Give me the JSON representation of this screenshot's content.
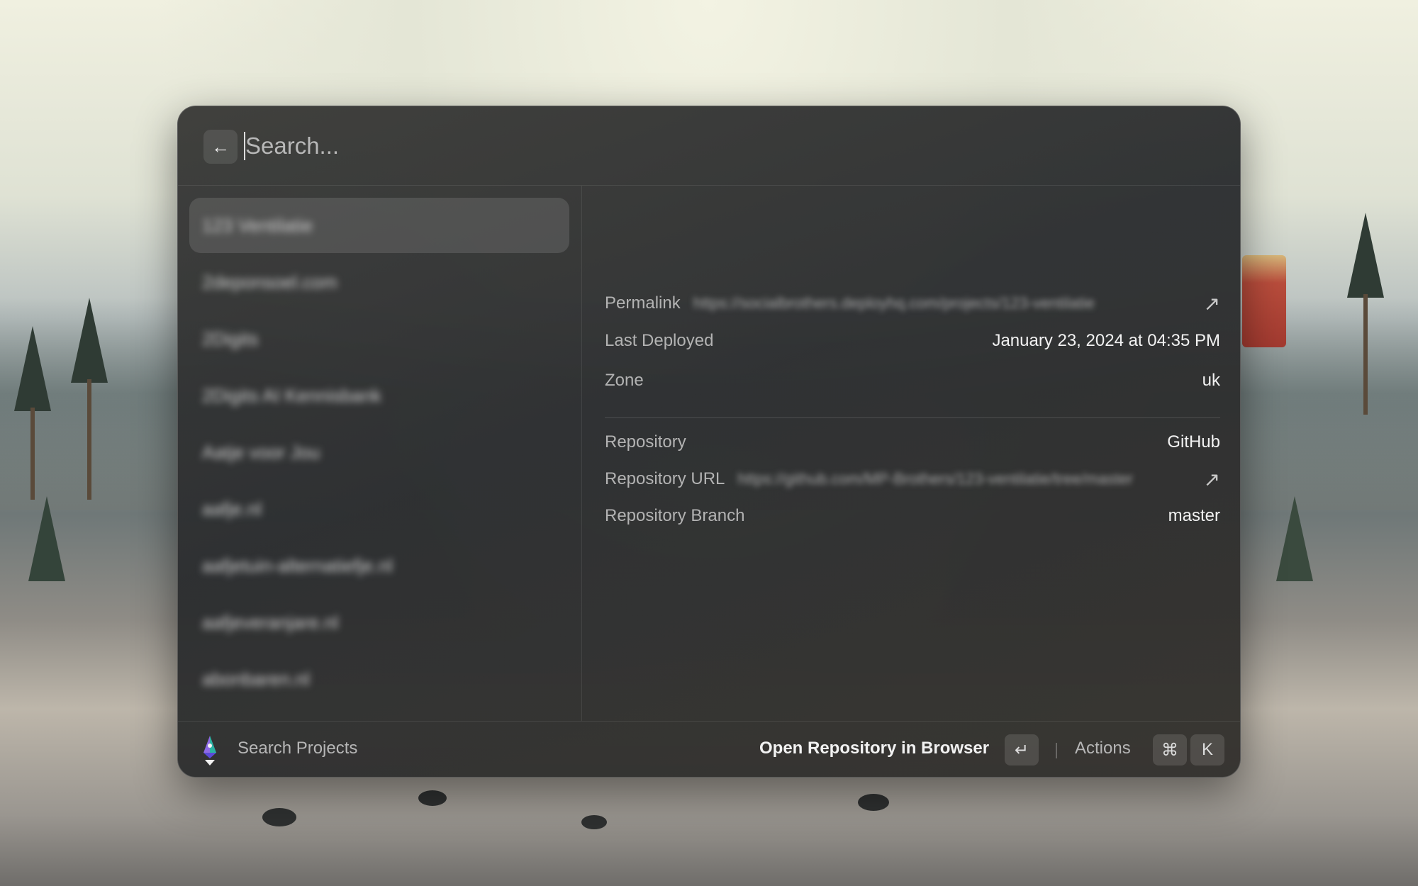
{
  "search": {
    "placeholder": "Search..."
  },
  "header": {
    "back_icon": "arrow-left-icon"
  },
  "projects": [
    {
      "label": "123 Ventilatie",
      "selected": true
    },
    {
      "label": "2deponsoel.com",
      "selected": false
    },
    {
      "label": "2Digits",
      "selected": false
    },
    {
      "label": "2Digits AI Kennisbank",
      "selected": false
    },
    {
      "label": "Aatje voor Jou",
      "selected": false
    },
    {
      "label": "aafje.nl",
      "selected": false
    },
    {
      "label": "aafjetuin-alternatiefje.nl",
      "selected": false
    },
    {
      "label": "aafjeveranjare.nl",
      "selected": false
    },
    {
      "label": "abonbaren.nl",
      "selected": false
    }
  ],
  "detail": {
    "permalink_label": "Permalink",
    "permalink_value": "https://socialbrothers.deployhq.com/projects/123-ventilatie",
    "last_deployed_label": "Last Deployed",
    "last_deployed_value": "January 23, 2024 at 04:35 PM",
    "zone_label": "Zone",
    "zone_value": "uk",
    "repository_label": "Repository",
    "repository_value": "GitHub",
    "repository_url_label": "Repository URL",
    "repository_url_value": "https://github.com/MP-Brothers/123-ventilatie/tree/master",
    "repository_branch_label": "Repository Branch",
    "repository_branch_value": "master"
  },
  "footer": {
    "title": "Search Projects",
    "primary_action": "Open Repository in Browser",
    "enter_key": "↵",
    "actions_label": "Actions",
    "cmd_key": "⌘",
    "k_key": "K"
  }
}
